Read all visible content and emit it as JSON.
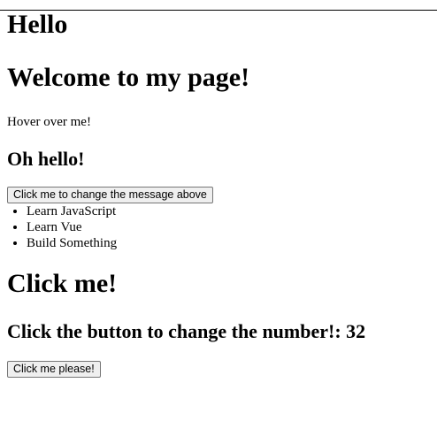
{
  "headings": {
    "hello": "Hello",
    "welcome": "Welcome to my page!",
    "oh_hello": "Oh hello!",
    "click_me": "Click me!",
    "number_prefix": "Click the button to change the number!: ",
    "number_value": "32"
  },
  "hover_text": "Hover over me!",
  "buttons": {
    "change_message": "Click me to change the message above",
    "click_please": "Click me please!"
  },
  "list": {
    "items": [
      "Learn JavaScript",
      "Learn Vue",
      "Build Something"
    ]
  }
}
